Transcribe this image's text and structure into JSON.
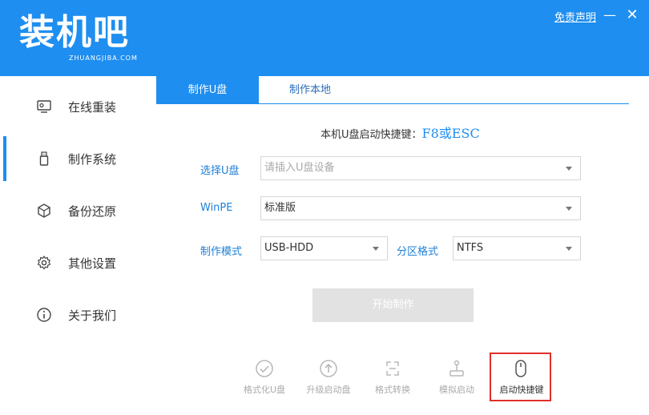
{
  "header": {
    "logo_main": "装机吧",
    "logo_sub": "ZHUANGJIBA.COM",
    "disclaimer": "免责声明",
    "minimize": "—",
    "close": "✕"
  },
  "sidebar": {
    "items": [
      {
        "label": "在线重装",
        "icon": "monitor-icon"
      },
      {
        "label": "制作系统",
        "icon": "usb-drive-icon",
        "active": true
      },
      {
        "label": "备份还原",
        "icon": "cube-icon"
      },
      {
        "label": "其他设置",
        "icon": "gear-icon"
      },
      {
        "label": "关于我们",
        "icon": "info-icon"
      }
    ]
  },
  "tabs": [
    {
      "label": "制作U盘",
      "active": true
    },
    {
      "label": "制作本地",
      "active": false
    }
  ],
  "hotkey": {
    "label": "本机U盘启动快捷键：",
    "value": "F8或ESC"
  },
  "form": {
    "usb_label": "选择U盘",
    "usb_placeholder": "请插入U盘设备",
    "winpe_label": "WinPE",
    "winpe_value": "标准版",
    "mode_label": "制作模式",
    "mode_value": "USB-HDD",
    "partition_label": "分区格式",
    "partition_value": "NTFS"
  },
  "start_button": "开始制作",
  "tools": [
    {
      "label": "格式化U盘",
      "icon": "check-circle-icon"
    },
    {
      "label": "升级启动盘",
      "icon": "arrow-up-circle-icon"
    },
    {
      "label": "格式转换",
      "icon": "convert-icon"
    },
    {
      "label": "模拟启动",
      "icon": "joystick-icon"
    },
    {
      "label": "启动快捷键",
      "icon": "mouse-icon",
      "highlighted": true
    }
  ],
  "colors": {
    "brand": "#1e8ef0",
    "highlight_border": "#e0302a"
  }
}
